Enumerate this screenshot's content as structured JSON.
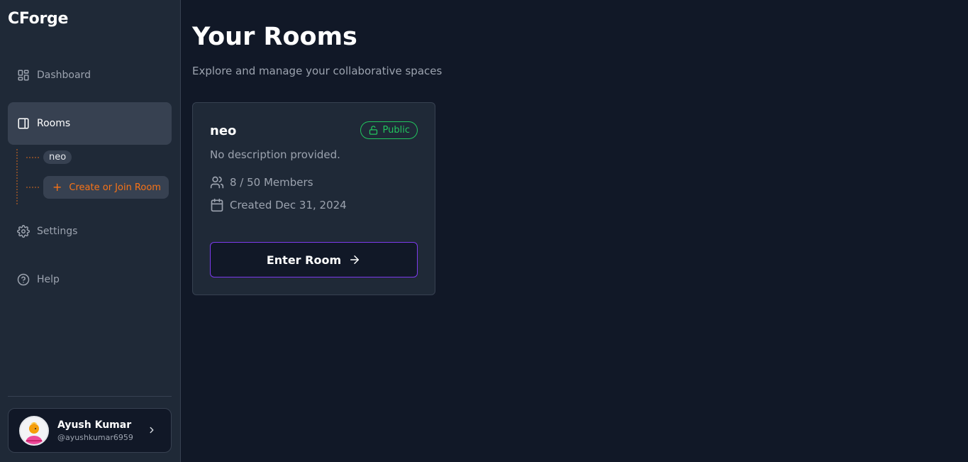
{
  "app": {
    "name": "CForge"
  },
  "sidebar": {
    "items": [
      {
        "label": "Dashboard",
        "icon": "dashboard-icon"
      },
      {
        "label": "Rooms",
        "icon": "rooms-icon"
      },
      {
        "label": "Settings",
        "icon": "gear-icon"
      },
      {
        "label": "Help",
        "icon": "help-icon"
      }
    ],
    "active": "Rooms",
    "rooms_subtree": {
      "rooms": [
        "neo"
      ],
      "create_label": "Create or Join Room"
    }
  },
  "user": {
    "name": "Ayush Kumar",
    "handle": "@ayushkumar6959"
  },
  "main": {
    "title": "Your Rooms",
    "subtitle": "Explore and manage your collaborative spaces",
    "rooms": [
      {
        "name": "neo",
        "visibility": "Public",
        "description": "No description provided.",
        "members": "8 / 50 Members",
        "created": "Created Dec 31, 2024",
        "cta": "Enter Room"
      }
    ]
  },
  "colors": {
    "background": "#111827",
    "sidebar": "#1f2937",
    "accent_orange": "#f97316",
    "public_green": "#22c55e",
    "button_border_purple": "#7c3aed"
  }
}
